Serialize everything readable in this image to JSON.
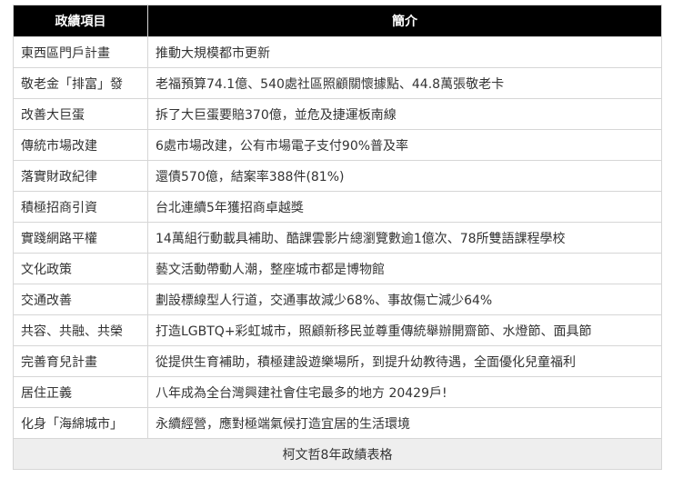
{
  "header": {
    "col1": "政績項目",
    "col2": "簡介"
  },
  "rows": [
    {
      "item": "東西區門戶計畫",
      "desc": "推動大規模都市更新"
    },
    {
      "item": "敬老金「排富」發",
      "desc": "老福預算74.1億、540處社區照顧關懷據點、44.8萬張敬老卡"
    },
    {
      "item": "改善大巨蛋",
      "desc": "拆了大巨蛋要賠370億，並危及捷運板南線"
    },
    {
      "item": "傳統市場改建",
      "desc": "6處市場改建，公有市場電子支付90%普及率"
    },
    {
      "item": "落實財政紀律",
      "desc": "還債570億，結案率388件(81%)"
    },
    {
      "item": "積極招商引資",
      "desc": "台北連續5年獲招商卓越獎"
    },
    {
      "item": "實踐網路平權",
      "desc": "14萬組行動載具補助、酷課雲影片總瀏覽數逾1億次、78所雙語課程學校"
    },
    {
      "item": "文化政策",
      "desc": "藝文活動帶動人潮，整座城市都是博物館"
    },
    {
      "item": "交通改善",
      "desc": "劃設標線型人行道，交通事故減少68%、事故傷亡減少64%"
    },
    {
      "item": "共容、共融、共榮",
      "desc": "打造LGBTQ+彩虹城市，照顧新移民並尊重傳統舉辦開齋節、水燈節、面具節"
    },
    {
      "item": "完善育兒計畫",
      "desc": "從提供生育補助，積極建設遊樂場所，到提升幼教待遇，全面優化兒童福利"
    },
    {
      "item": "居住正義",
      "desc": "八年成為全台灣興建社會住宅最多的地方 20429戶!"
    },
    {
      "item": "化身「海綿城市」",
      "desc": "永續經營，應對極端氣候打造宜居的生活環境"
    }
  ],
  "caption": "柯文哲8年政績表格"
}
